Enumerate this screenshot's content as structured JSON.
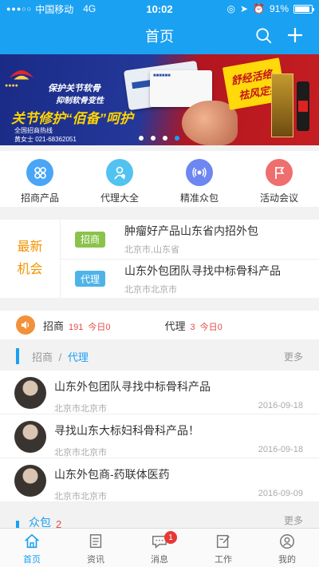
{
  "status_bar": {
    "carrier": "中国移动",
    "network": "4G",
    "time": "10:02",
    "battery": "91%",
    "battery_level": 0.91
  },
  "navbar": {
    "title": "首页",
    "search_icon": "search-icon",
    "add_icon": "plus-icon"
  },
  "banner": {
    "slogan1": "保护关节软骨",
    "slogan2": "抑制软骨变性",
    "headline": "关节修护“佰备”呵护",
    "hotline_label": "全国招商热线",
    "hotline": "黄女士  021-68362051",
    "badge_line1": "舒经活络",
    "badge_line2": "祛风定痛",
    "pages": 4,
    "active_page": 4
  },
  "quick_nav": [
    {
      "label": "招商产品",
      "color": "#4aa6f5",
      "icon": "grid-icon"
    },
    {
      "label": "代理大全",
      "color": "#52c3f1",
      "icon": "person-icon"
    },
    {
      "label": "精准众包",
      "color": "#6e86f0",
      "icon": "broadcast-icon"
    },
    {
      "label": "活动会议",
      "color": "#ef6e6e",
      "icon": "flag-icon"
    }
  ],
  "opportunities": {
    "title_line1": "最新",
    "title_line2": "机会",
    "items": [
      {
        "tag": "招商",
        "title": "肿瘤好产品山东省内招外包",
        "location": "北京市,山东省"
      },
      {
        "tag": "代理",
        "title": "山东外包团队寻找中标骨科产品",
        "location": "北京市北京市"
      }
    ]
  },
  "stats": {
    "zhaoshang_label": "招商",
    "zhaoshang_count": "191",
    "zhaoshang_today": "今日0",
    "daili_label": "代理",
    "daili_count": "3",
    "daili_today": "今日0"
  },
  "feed_section": {
    "crumb_inactive": "招商",
    "separator": "/",
    "crumb_active": "代理",
    "more": "更多",
    "items": [
      {
        "title": "山东外包团队寻找中标骨科产品",
        "location": "北京市北京市",
        "date": "2016-09-18"
      },
      {
        "title": "寻找山东大标妇科骨科产品！",
        "location": "北京市北京市",
        "date": "2016-09-18"
      },
      {
        "title": "山东外包商-药联体医药",
        "location": "北京市北京市",
        "date": "2016-09-09"
      }
    ]
  },
  "section2": {
    "title": "众包",
    "count": "2",
    "more": "更多"
  },
  "tabbar": [
    {
      "label": "首页",
      "icon": "home-icon",
      "active": true
    },
    {
      "label": "资讯",
      "icon": "news-icon",
      "active": false
    },
    {
      "label": "消息",
      "icon": "message-icon",
      "active": false,
      "badge": "1"
    },
    {
      "label": "工作",
      "icon": "edit-icon",
      "active": false
    },
    {
      "label": "我的",
      "icon": "profile-icon",
      "active": false
    }
  ]
}
